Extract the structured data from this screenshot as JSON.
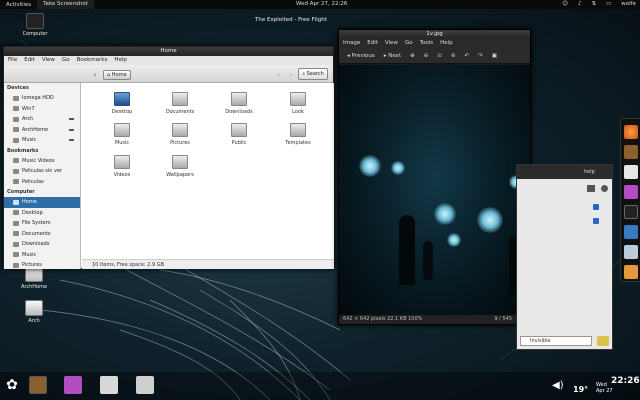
{
  "topbar": {
    "activities": "Activities",
    "active_app": "Take Screenshot",
    "clock": "Wed Apr 27, 22:26",
    "user": "wolfe"
  },
  "desktop_icons": [
    "Computer",
    "ArchHome",
    "Arch"
  ],
  "exploited_title": "The Exploited - Free Flight",
  "nautilus": {
    "title": "Home",
    "menu": [
      "File",
      "Edit",
      "View",
      "Go",
      "Bookmarks",
      "Help"
    ],
    "path": "Home",
    "search": "Search",
    "sidebar": {
      "devices_header": "Devices",
      "devices": [
        "Iomega HDD",
        "Win7",
        "Arch",
        "ArchHome",
        "Music"
      ],
      "bookmarks_header": "Bookmarks",
      "bookmarks": [
        "Music Videos",
        "Peliculas sin ver",
        "Peliculas"
      ],
      "computer_header": "Computer",
      "computer": [
        "Home",
        "Desktop",
        "File System",
        "Documents",
        "Downloads",
        "Music",
        "Pictures"
      ]
    },
    "files": [
      "Desktop",
      "Documents",
      "Downloads",
      "Look",
      "Music",
      "Pictures",
      "Public",
      "Templates",
      "Videos",
      "Wallpapers"
    ],
    "status": "10 items, Free space: 2.9 GB"
  },
  "eog": {
    "title": "1v.jpg",
    "menu": [
      "Image",
      "Edit",
      "View",
      "Go",
      "Tools",
      "Help"
    ],
    "previous": "Previous",
    "next": "Next",
    "status_info": "642 × 642 pixels   22.1 KB   100%",
    "page": "9 / 545"
  },
  "partial_window": {
    "title": "help",
    "status": "Invisible"
  },
  "bottom": {
    "clock": "22:26",
    "day": "Wed",
    "date": "Apr 27",
    "temp": "19°"
  },
  "colors": {
    "selection": "#2e6ea8",
    "panel": "#0a0a0a"
  }
}
